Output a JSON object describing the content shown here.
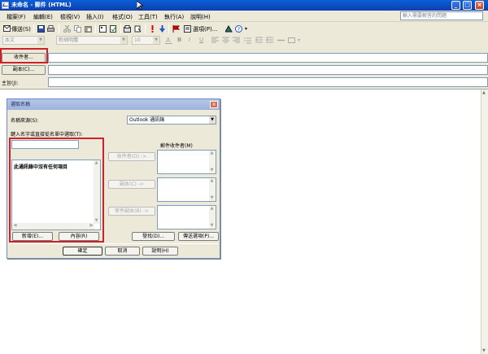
{
  "window": {
    "title": "未命名 - 郵件 (HTML)",
    "min": "_",
    "max": "□",
    "close": "×"
  },
  "menu": {
    "items": [
      "檔案(F)",
      "編輯(E)",
      "檢視(V)",
      "插入(I)",
      "格式(O)",
      "工具(T)",
      "執行(A)",
      "說明(H)"
    ],
    "help_placeholder": "輸入需要解答的問題"
  },
  "toolbar": {
    "send": "傳送(S)",
    "options": "選項(P)...",
    "font_style": "本文",
    "font_name": "新細明體",
    "font_size": "10",
    "bold": "B",
    "italic": "I",
    "underline": "U"
  },
  "header": {
    "to_button": "收件者...",
    "cc_button": "副本(C)...",
    "subject_label": "主旨(J):"
  },
  "dialog": {
    "title": "選取名稱",
    "source_label": "名稱來源(S):",
    "source_value": "Outlook 通訊錄",
    "type_label": "鍵入名字或直接從名單中選取(T):",
    "recipients_label": "郵件收件者(M)",
    "empty_message": "此通訊錄中沒有任何項目",
    "to_btn": "收件者(O) ->",
    "cc_btn": "副本(C) ->",
    "bcc_btn": "密件副本(B) ->",
    "new_btn": "新增(E)...",
    "properties_btn": "內容(R)",
    "advanced_btn": "發找(D)...",
    "send_options_btn": "傳送選項(P)...",
    "ok_btn": "確定",
    "cancel_btn": "取消",
    "help_btn": "說明(H)"
  }
}
